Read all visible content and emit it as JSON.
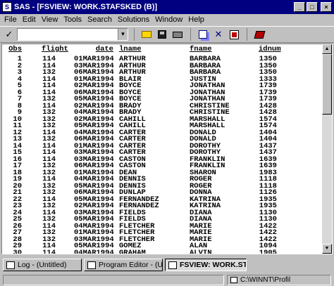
{
  "window": {
    "title": "SAS - [FSVIEW:  WORK.STAFSKED (B)]",
    "app_icon": "sas-app-icon",
    "min_label": "_",
    "max_label": "□",
    "close_label": "×"
  },
  "menu": [
    "File",
    "Edit",
    "View",
    "Tools",
    "Search",
    "Solutions",
    "Window",
    "Help"
  ],
  "toolbar": {
    "command_value": "",
    "dropdown_glyph": "▼",
    "check_glyph": "✓",
    "close_glyph": "✕"
  },
  "table": {
    "columns": [
      "Obs",
      "flight",
      "date",
      "lname",
      "fname",
      "idnum"
    ],
    "rows": [
      [
        "1",
        "114",
        "01MAR1994",
        "ARTHUR",
        "BARBARA",
        "1350"
      ],
      [
        "2",
        "114",
        "03MAR1994",
        "ARTHUR",
        "BARBARA",
        "1350"
      ],
      [
        "3",
        "132",
        "06MAR1994",
        "ARTHUR",
        "BARBARA",
        "1350"
      ],
      [
        "4",
        "114",
        "01MAR1994",
        "BLAIR",
        "JUSTIN",
        "1333"
      ],
      [
        "5",
        "114",
        "02MAR1994",
        "BOYCE",
        "JONATHAN",
        "1739"
      ],
      [
        "6",
        "114",
        "06MAR1994",
        "BOYCE",
        "JONATHAN",
        "1739"
      ],
      [
        "7",
        "132",
        "05MAR1994",
        "BOYCE",
        "JONATHAN",
        "1739"
      ],
      [
        "8",
        "114",
        "02MAR1994",
        "BRADY",
        "CHRISTINE",
        "1428"
      ],
      [
        "9",
        "132",
        "04MAR1994",
        "BRADY",
        "CHRISTINE",
        "1428"
      ],
      [
        "10",
        "132",
        "02MAR1994",
        "CAHILL",
        "MARSHALL",
        "1574"
      ],
      [
        "11",
        "132",
        "05MAR1994",
        "CAHILL",
        "MARSHALL",
        "1574"
      ],
      [
        "12",
        "114",
        "04MAR1994",
        "CARTER",
        "DONALD",
        "1404"
      ],
      [
        "13",
        "132",
        "06MAR1994",
        "CARTER",
        "DONALD",
        "1404"
      ],
      [
        "14",
        "114",
        "01MAR1994",
        "CARTER",
        "DOROTHY",
        "1437"
      ],
      [
        "15",
        "114",
        "03MAR1994",
        "CARTER",
        "DOROTHY",
        "1437"
      ],
      [
        "16",
        "114",
        "03MAR1994",
        "CASTON",
        "FRANKLIN",
        "1639"
      ],
      [
        "17",
        "132",
        "06MAR1994",
        "CASTON",
        "FRANKLIN",
        "1639"
      ],
      [
        "18",
        "132",
        "01MAR1994",
        "DEAN",
        "SHARON",
        "1983"
      ],
      [
        "19",
        "114",
        "04MAR1994",
        "DENNIS",
        "ROGER",
        "1118"
      ],
      [
        "20",
        "132",
        "05MAR1994",
        "DENNIS",
        "ROGER",
        "1118"
      ],
      [
        "21",
        "132",
        "06MAR1994",
        "DUNLAP",
        "DONNA",
        "1126"
      ],
      [
        "22",
        "114",
        "05MAR1994",
        "FERNANDEZ",
        "KATRINA",
        "1935"
      ],
      [
        "23",
        "132",
        "02MAR1994",
        "FERNANDEZ",
        "KATRINA",
        "1935"
      ],
      [
        "24",
        "114",
        "03MAR1994",
        "FIELDS",
        "DIANA",
        "1130"
      ],
      [
        "25",
        "132",
        "05MAR1994",
        "FIELDS",
        "DIANA",
        "1130"
      ],
      [
        "26",
        "114",
        "04MAR1994",
        "FLETCHER",
        "MARIE",
        "1422"
      ],
      [
        "27",
        "132",
        "01MAR1994",
        "FLETCHER",
        "MARIE",
        "1422"
      ],
      [
        "28",
        "132",
        "03MAR1994",
        "FLETCHER",
        "MARIE",
        "1422"
      ],
      [
        "29",
        "114",
        "05MAR1994",
        "GOMEZ",
        "ALAN",
        "1094"
      ],
      [
        "30",
        "114",
        "04MAR1994",
        "GRAHAM",
        "ALVIN",
        "1905"
      ]
    ]
  },
  "taskbar": [
    {
      "label": "Log - (Untitled)",
      "active": false
    },
    {
      "label": "Program Editor - (Untitled)",
      "active": false
    },
    {
      "label": "FSVIEW:  WORK.ST...",
      "active": true
    }
  ],
  "status": {
    "path": "C:\\WINNT\\Profil"
  }
}
